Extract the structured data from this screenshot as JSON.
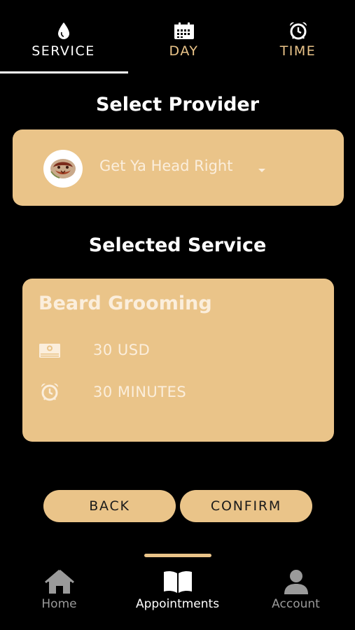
{
  "tabs": [
    {
      "label": "SERVICE",
      "icon": "drop-icon",
      "active": true
    },
    {
      "label": "DAY",
      "icon": "calendar-icon",
      "active": false
    },
    {
      "label": "TIME",
      "icon": "alarm-clock-icon",
      "active": false
    }
  ],
  "provider": {
    "heading": "Select Provider",
    "name": "Get Ya Head Right"
  },
  "service": {
    "heading": "Selected Service",
    "name": "Beard Grooming",
    "price": "30 USD",
    "duration": "30 MINUTES"
  },
  "actions": {
    "back_label": "BACK",
    "confirm_label": "CONFIRM"
  },
  "nav": [
    {
      "label": "Home",
      "icon": "home-icon",
      "active": false
    },
    {
      "label": "Appointments",
      "icon": "book-icon",
      "active": true
    },
    {
      "label": "Account",
      "icon": "user-icon",
      "active": false
    }
  ],
  "colors": {
    "background": "#000000",
    "accent": "#eac489",
    "card_text": "#fbeedc",
    "inactive_nav": "#9a9a9a"
  }
}
